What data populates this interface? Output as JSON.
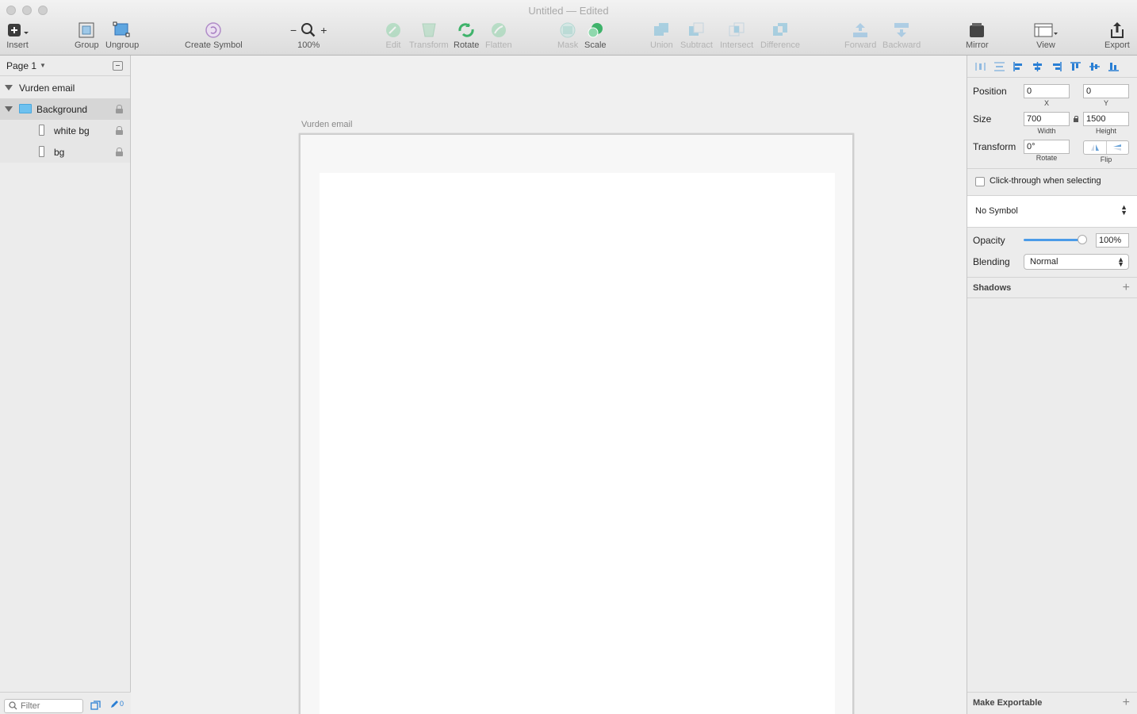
{
  "window": {
    "title": "Untitled",
    "status": "— Edited"
  },
  "toolbar": {
    "insert": "Insert",
    "group": "Group",
    "ungroup": "Ungroup",
    "create_symbol": "Create Symbol",
    "zoom_minus": "−",
    "zoom_plus": "+",
    "zoom_level": "100%",
    "edit": "Edit",
    "transform": "Transform",
    "rotate": "Rotate",
    "flatten": "Flatten",
    "mask": "Mask",
    "scale": "Scale",
    "union": "Union",
    "subtract": "Subtract",
    "intersect": "Intersect",
    "difference": "Difference",
    "forward": "Forward",
    "backward": "Backward",
    "mirror": "Mirror",
    "view": "View",
    "export": "Export"
  },
  "layers": {
    "page": "Page 1",
    "items": [
      {
        "name": "Vurden email"
      },
      {
        "name": "Background"
      },
      {
        "name": "white bg"
      },
      {
        "name": "bg"
      }
    ],
    "filter_placeholder": "Filter",
    "edit_count": "0"
  },
  "canvas": {
    "artboard_name": "Vurden email"
  },
  "inspector": {
    "position_label": "Position",
    "x": "0",
    "y": "0",
    "x_label": "X",
    "y_label": "Y",
    "size_label": "Size",
    "width": "700",
    "height": "1500",
    "width_label": "Width",
    "height_label": "Height",
    "transform_label": "Transform",
    "rotate": "0°",
    "rotate_label": "Rotate",
    "flip_label": "Flip",
    "click_through": "Click-through when selecting",
    "symbol": "No Symbol",
    "opacity_label": "Opacity",
    "opacity": "100%",
    "blending_label": "Blending",
    "blending": "Normal",
    "shadows": "Shadows",
    "make_exportable": "Make Exportable"
  },
  "colors": {
    "accent": "#4b9be8",
    "folder": "#6ec1ef",
    "green_tool": "#3fb36b"
  }
}
